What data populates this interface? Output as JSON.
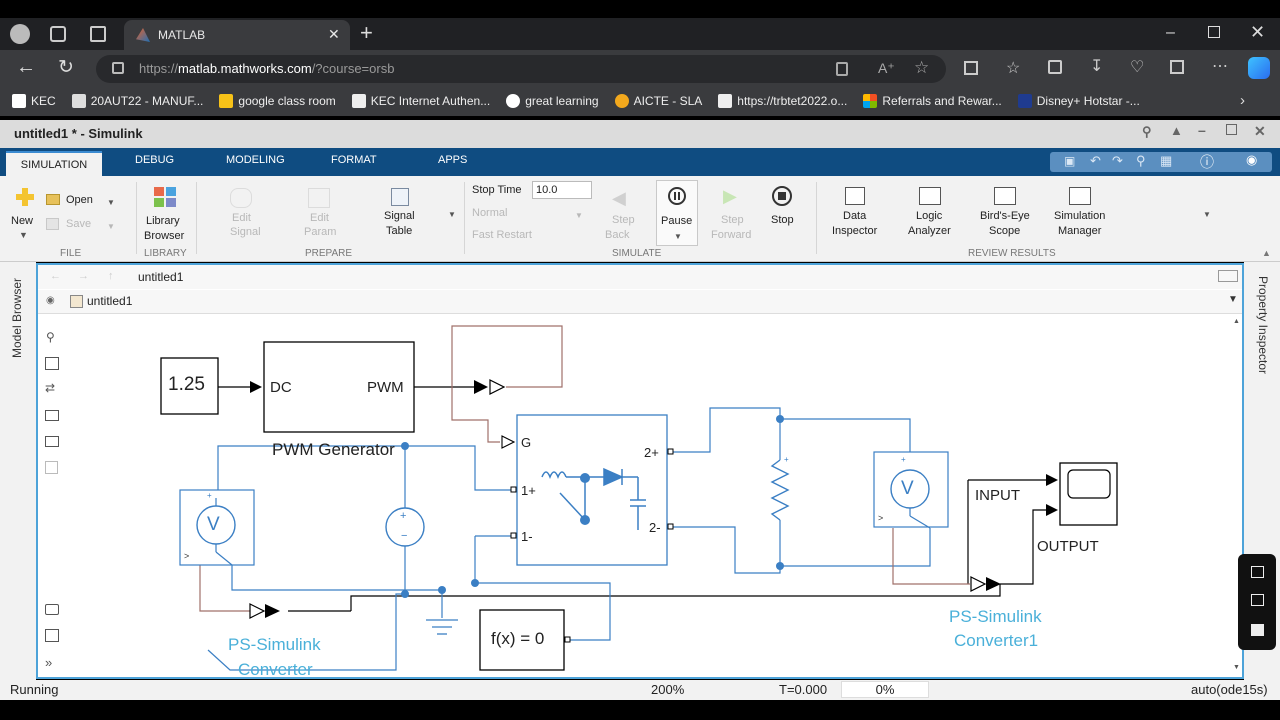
{
  "browser": {
    "tab_title": "MATLAB",
    "url_prefix": "https://",
    "url_host": "matlab.mathworks.com",
    "url_path": "/?course=orsb",
    "bookmarks": [
      {
        "label": "KEC",
        "color": "#ffffff"
      },
      {
        "label": "20AUT22 - MANUF...",
        "color": "#dddddd"
      },
      {
        "label": "google class room",
        "color": "#f7c218"
      },
      {
        "label": "KEC Internet Authen...",
        "color": "#eeeeee"
      },
      {
        "label": "great learning",
        "color": "#ffffff"
      },
      {
        "label": "AICTE - SLA",
        "color": "#f2a81d"
      },
      {
        "label": "https://trbtet2022.o...",
        "color": "#eeeeee"
      },
      {
        "label": "Referrals and Rewar...",
        "color": "#f25022"
      },
      {
        "label": "Disney+ Hotstar -...",
        "color": "#1f3b8f"
      }
    ]
  },
  "window": {
    "title": "untitled1 * - Simulink"
  },
  "ribbon": {
    "tabs": [
      "SIMULATION",
      "DEBUG",
      "MODELING",
      "FORMAT",
      "APPS"
    ],
    "file": {
      "new": "New",
      "open": "Open",
      "save": "Save",
      "section": "FILE"
    },
    "library": {
      "browser1": "Library",
      "browser2": "Browser",
      "section": "LIBRARY"
    },
    "prepare": {
      "edit1": "Edit",
      "edit2": "Signal",
      "edit3": "Edit",
      "edit4": "Param",
      "signal1": "Signal",
      "signal2": "Table",
      "section": "PREPARE"
    },
    "simulate": {
      "stop_time_label": "Stop Time",
      "stop_time_value": "10.0",
      "mode": "Normal",
      "fast_restart": "Fast Restart",
      "step_back1": "Step",
      "step_back2": "Back",
      "pause": "Pause",
      "step_fwd1": "Step",
      "step_fwd2": "Forward",
      "stop": "Stop",
      "section": "SIMULATE"
    },
    "review": {
      "data1": "Data",
      "data2": "Inspector",
      "logic1": "Logic",
      "logic2": "Analyzer",
      "birds1": "Bird's-Eye",
      "birds2": "Scope",
      "simmgr1": "Simulation",
      "simmgr2": "Manager",
      "section": "REVIEW RESULTS"
    }
  },
  "canvas": {
    "tab": "untitled1",
    "breadcrumb": "untitled1",
    "left_panel": "Model Browser",
    "right_panel": "Property Inspector"
  },
  "diagram": {
    "constant_value": "1.25",
    "pwm_in": "DC",
    "pwm_out": "PWM",
    "pwm_name": "PWM Generator",
    "switch_g": "G",
    "port_1p": "1+",
    "port_1m": "1-",
    "port_2p": "2+",
    "port_2m": "2-",
    "voltmeter_symbol": "V",
    "fx_block": "f(x) = 0",
    "ps_conv1": "PS-Simulink",
    "ps_conv2": "Converter",
    "ps_conv1b": "PS-Simulink",
    "ps_conv2b": "Converter1",
    "scope_in": "INPUT",
    "scope_out": "OUTPUT"
  },
  "status": {
    "state": "Running",
    "zoom": "200%",
    "time": "T=0.000",
    "progress": "0%",
    "solver": "auto(ode15s)"
  }
}
